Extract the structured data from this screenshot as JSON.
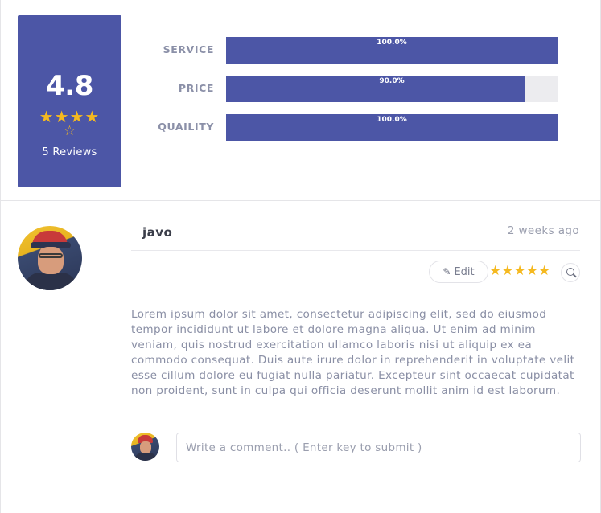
{
  "summary": {
    "score": "4.8",
    "stars_row1": "★★★★",
    "stars_row2": "☆",
    "reviews_label": "5 Reviews",
    "rating_value": 4.8,
    "rating_max": 5
  },
  "categories": [
    {
      "label": "SERVICE",
      "percent_text": "100.0%",
      "percent": 100.0
    },
    {
      "label": "PRICE",
      "percent_text": "90.0%",
      "percent": 90.0
    },
    {
      "label": "QUAILITY",
      "percent_text": "100.0%",
      "percent": 100.0
    }
  ],
  "review": {
    "author": "javo",
    "time_ago": "2 weeks ago",
    "edit_label": "Edit",
    "stars": "★★★★★",
    "rating": 5,
    "text": "Lorem ipsum dolor sit amet, consectetur adipiscing elit, sed do eiusmod tempor incididunt ut labore et dolore magna aliqua. Ut enim ad minim veniam, quis nostrud exercitation ullamco laboris nisi ut aliquip ex ea commodo consequat. Duis aute irure dolor in reprehenderit in voluptate velit esse cillum dolore eu fugiat nulla pariatur. Excepteur sint occaecat cupidatat non proident, sunt in culpa qui officia deserunt mollit anim id est laborum."
  },
  "comment": {
    "placeholder": "Write a comment.. ( Enter key to submit )",
    "value": ""
  },
  "colors": {
    "accent": "#4c56a6",
    "star": "#f5b920",
    "track": "#ececef"
  },
  "icons": {
    "edit": "pencil-icon",
    "zoom": "search-icon"
  }
}
